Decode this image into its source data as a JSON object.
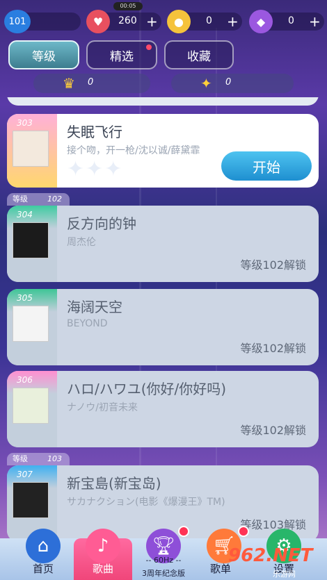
{
  "status": {
    "clock": "00:05"
  },
  "resources": {
    "level": "101",
    "hearts": "260",
    "coins": "0",
    "diamonds": "0",
    "plus": "+"
  },
  "tabs": [
    {
      "label": "等级"
    },
    {
      "label": "精选"
    },
    {
      "label": "收藏"
    }
  ],
  "stats": {
    "crowns": "0",
    "stars": "0"
  },
  "songs": [
    {
      "num": "303",
      "title": "失眠飞行",
      "artist": "接个吻，开一枪/沈以诚/薛黛霏",
      "action": "开始"
    },
    {
      "num": "304",
      "title": "反方向的钟",
      "artist": "周杰伦",
      "unlock": "等级102解锁"
    },
    {
      "num": "305",
      "title": "海阔天空",
      "artist": "BEYOND",
      "unlock": "等级102解锁"
    },
    {
      "num": "306",
      "title": "ハロ/ハワユ(你好/你好吗)",
      "artist": "ナノウ/初音未来",
      "unlock": "等级102解锁"
    },
    {
      "num": "307",
      "title": "新宝島(新宝岛)",
      "artist": "サカナクション(电影《爆漫王》TM)",
      "unlock": "等级103解锁"
    }
  ],
  "level_headers": [
    {
      "label": "等级",
      "value": "102"
    },
    {
      "label": "等级",
      "value": "103"
    }
  ],
  "nav": {
    "home": "首页",
    "songs": "歌曲",
    "hz": "-- 60Hz --",
    "anniversary": "3周年纪念版",
    "setlist": "歌单",
    "settings": "设置"
  },
  "watermark": {
    "brand": "962.NET",
    "sub": "乐游网"
  },
  "colors": {
    "accent": "#1e8fd0",
    "active_tab": "#4a8fa0",
    "nav_active": "#f0467a"
  }
}
